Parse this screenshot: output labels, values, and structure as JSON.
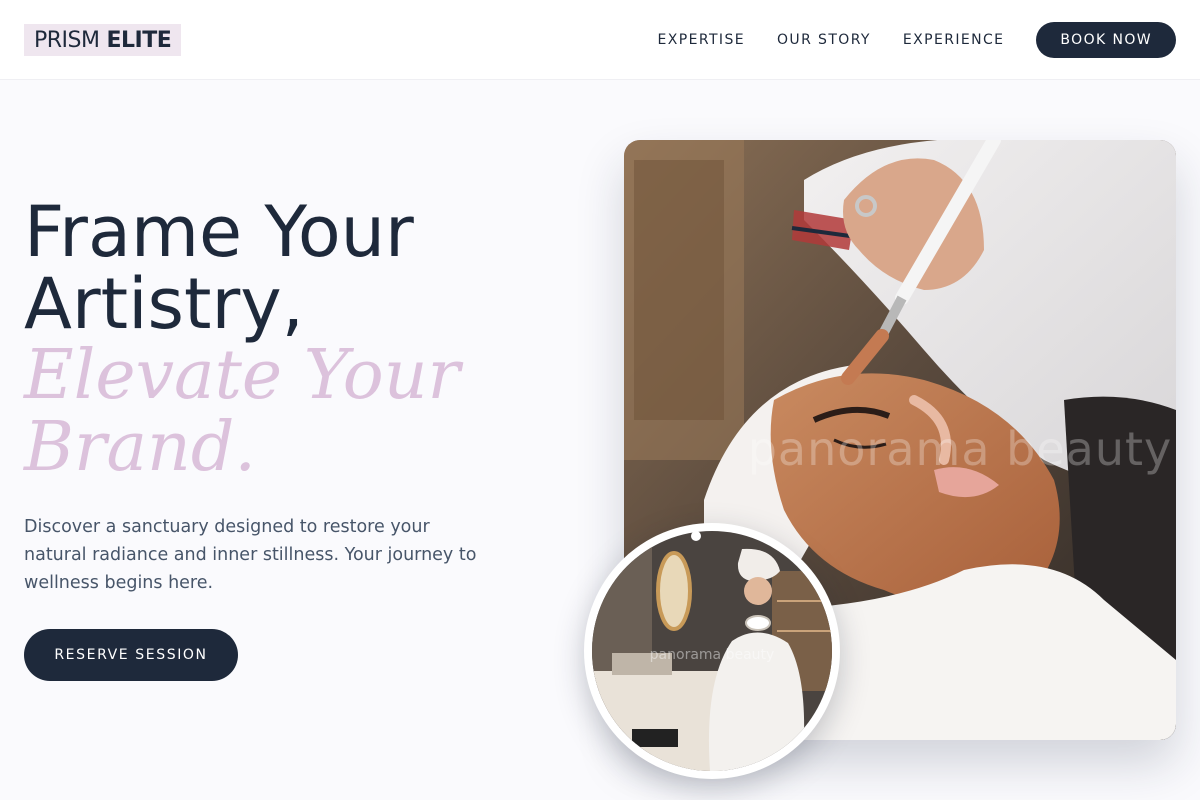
{
  "brand": {
    "name_light": "PRISM",
    "name_bold": "ELITE"
  },
  "nav": {
    "links": [
      "EXPERTISE",
      "OUR STORY",
      "EXPERIENCE"
    ],
    "cta": "BOOK NOW"
  },
  "hero": {
    "title_line1": "Frame Your",
    "title_line2": "Artistry,",
    "accent_line1": "Elevate Your",
    "accent_line2": "Brand.",
    "description": "Discover a sanctuary designed to restore your natural radiance and inner stillness. Your journey to wellness begins here.",
    "cta": "RESERVE SESSION"
  },
  "images": {
    "main_watermark": "panorama beauty",
    "circle_watermark": "panorama beauty"
  },
  "colors": {
    "primary": "#1e293b",
    "accent": "#dcc2dc",
    "logo_bg": "#efe6ef",
    "background": "#fafafd"
  }
}
